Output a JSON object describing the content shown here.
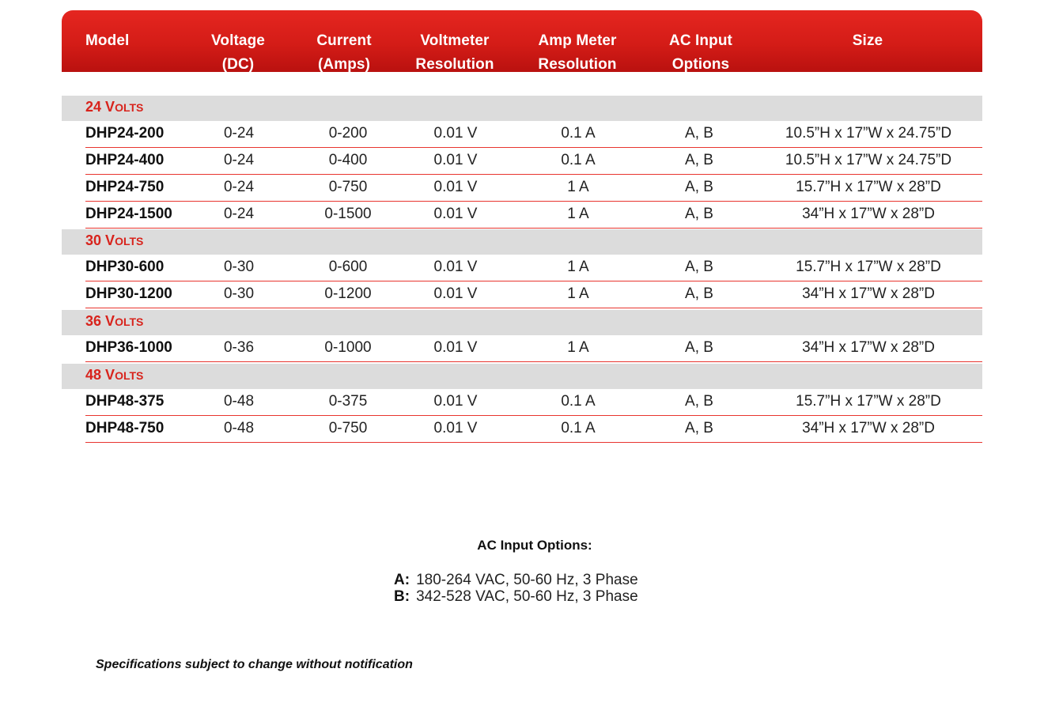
{
  "table": {
    "headers": [
      [
        "Model"
      ],
      [
        "Voltage",
        "(DC)"
      ],
      [
        "Current",
        "(Amps)"
      ],
      [
        "Voltmeter",
        "Resolution"
      ],
      [
        "Amp Meter",
        "Resolution"
      ],
      [
        "AC Input",
        "Options"
      ],
      [
        "Size"
      ]
    ],
    "groups": [
      {
        "label_num": "24",
        "label_first": "V",
        "label_rest": "OLTS",
        "rows": [
          {
            "model": "DHP24-200",
            "voltage": "0-24",
            "current": "0-200",
            "voltmeter": "0.01 V",
            "ampmeter": "0.1 A",
            "ac": "A, B",
            "size": "10.5”H x 17”W x 24.75”D"
          },
          {
            "model": "DHP24-400",
            "voltage": "0-24",
            "current": "0-400",
            "voltmeter": "0.01 V",
            "ampmeter": "0.1 A",
            "ac": "A, B",
            "size": "10.5”H x 17”W x 24.75”D"
          },
          {
            "model": "DHP24-750",
            "voltage": "0-24",
            "current": "0-750",
            "voltmeter": "0.01 V",
            "ampmeter": "1 A",
            "ac": "A, B",
            "size": "15.7”H x 17”W x 28”D"
          },
          {
            "model": "DHP24-1500",
            "voltage": "0-24",
            "current": "0-1500",
            "voltmeter": "0.01 V",
            "ampmeter": "1 A",
            "ac": "A, B",
            "size": "34”H x 17”W x 28”D"
          }
        ]
      },
      {
        "label_num": "30",
        "label_first": "V",
        "label_rest": "OLTS",
        "rows": [
          {
            "model": "DHP30-600",
            "voltage": "0-30",
            "current": "0-600",
            "voltmeter": "0.01 V",
            "ampmeter": "1 A",
            "ac": "A, B",
            "size": "15.7”H x 17”W x 28”D"
          },
          {
            "model": "DHP30-1200",
            "voltage": "0-30",
            "current": "0-1200",
            "voltmeter": "0.01 V",
            "ampmeter": "1 A",
            "ac": "A, B",
            "size": "34”H x 17”W x 28”D"
          }
        ]
      },
      {
        "label_num": "36",
        "label_first": "V",
        "label_rest": "OLTS",
        "rows": [
          {
            "model": "DHP36-1000",
            "voltage": "0-36",
            "current": "0-1000",
            "voltmeter": "0.01 V",
            "ampmeter": "1 A",
            "ac": "A, B",
            "size": "34”H x 17”W x 28”D"
          }
        ]
      },
      {
        "label_num": "48",
        "label_first": "V",
        "label_rest": "OLTS",
        "rows": [
          {
            "model": "DHP48-375",
            "voltage": "0-48",
            "current": "0-375",
            "voltmeter": "0.01 V",
            "ampmeter": "0.1 A",
            "ac": "A, B",
            "size": "15.7”H x 17”W x 28”D"
          },
          {
            "model": "DHP48-750",
            "voltage": "0-48",
            "current": "0-750",
            "voltmeter": "0.01 V",
            "ampmeter": "0.1 A",
            "ac": "A, B",
            "size": "34”H x 17”W x 28”D"
          }
        ]
      }
    ]
  },
  "ac_options": {
    "title": "AC Input Options:",
    "items": [
      {
        "key": "A",
        "sep": ":",
        "text": "180-264 VAC, 50-60 Hz, 3 Phase"
      },
      {
        "key": "B",
        "sep": ":",
        "text": "342-528 VAC, 50-60 Hz, 3 Phase"
      }
    ]
  },
  "footnote": "Specifications subject to change without notification",
  "colors": {
    "header_red": "#d41c17",
    "accent_red": "#d8231c",
    "group_band": "#dcdcdc",
    "row_rule": "#e8352f"
  }
}
